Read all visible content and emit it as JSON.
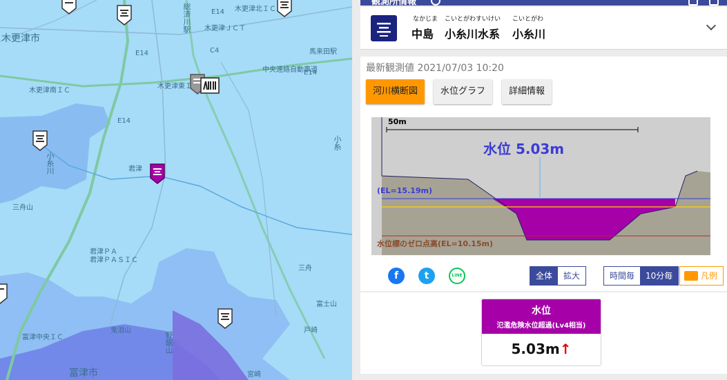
{
  "map": {
    "labels": {
      "kisarazu_city": "木更津市",
      "kisarazu_minami_ic": "木更津南ＩＣ",
      "kisarazu_jct": "木更津ＪＣＴ",
      "kisarazu_higashi_ic": "木更津東ＩＣ",
      "kisarazu_kita_ic": "木更津北ＩＣ",
      "souzen_station": "総済川駅",
      "chuo_road": "中央連絡自動車道",
      "mamita_eki": "馬来田駅",
      "koitogawa": "小糸川",
      "kimitsu": "君津",
      "sanjuu_yama": "三舟山",
      "kimitsu_pa": "君津ＰＡ",
      "kimitsu_pasic": "君津ＰＡＳＩＣ",
      "futtsu_chuo_ic": "富津中央ＩＣ",
      "futtsu_city": "富津市",
      "kominato": "小糸",
      "kanatake": "鬼泪山",
      "nokogiriyama": "野鋸山",
      "misato": "三舟",
      "hinode": "戸崎",
      "fujimi": "富士山",
      "hakamasaki": "宮崎",
      "e14_1": "E14",
      "e14_2": "E14",
      "e14_3": "E14",
      "c4": "C4",
      "e14_4": "E14"
    }
  },
  "panel": {
    "top_title": "観測所情報",
    "station": {
      "ruby_nakajima": "なかじま",
      "name_nakajima": "中島",
      "ruby_system": "こいとがわすいけい",
      "name_system": "小糸川水系",
      "ruby_river": "こいとがわ",
      "name_river": "小糸川"
    },
    "observation": {
      "label": "最新観測値 2021/07/03 10:20"
    },
    "tabs": [
      {
        "label": "河川横断図",
        "active": true
      },
      {
        "label": "水位グラフ",
        "active": false
      },
      {
        "label": "詳細情報",
        "active": false
      }
    ],
    "section": {
      "scale": "50m",
      "water_level": "水位 5.03m",
      "el": "(EL=15.19m)",
      "zero_point": "水位標のゼロ点高(EL=10.15m)"
    },
    "social": {
      "facebook": "f",
      "twitter": "t",
      "line": "LINE"
    },
    "range_toggle": [
      "全体",
      "拡大"
    ],
    "interval_toggle": [
      "時間毎",
      "10分毎"
    ],
    "legend": "凡例",
    "status": {
      "title": "水位",
      "status_text": "氾濫危険水位超過(Lv4相当)",
      "value": "5.03m",
      "trend": "↑",
      "color": "#a600a8"
    }
  }
}
